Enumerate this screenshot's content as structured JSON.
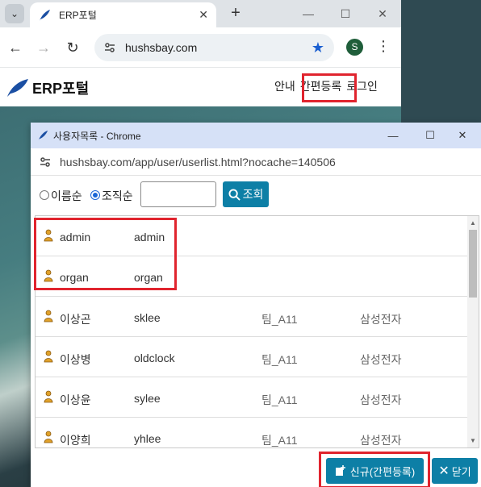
{
  "browser": {
    "tab_title": "ERP포털",
    "url": "hushsbay.com",
    "profile_initial": "S"
  },
  "site": {
    "brand": "ERP포털",
    "nav": [
      "안내",
      "간편등록",
      "로그인"
    ]
  },
  "popup": {
    "title": "사용자목록 - Chrome",
    "url": "hushsbay.com/app/user/userlist.html?nocache=140506",
    "search": {
      "radio_name": "이름순",
      "radio_org": "조직순",
      "selected": "조직순",
      "input_value": "",
      "search_button": "조회"
    },
    "users": [
      {
        "name": "admin",
        "id": "admin",
        "team": "",
        "company": ""
      },
      {
        "name": "organ",
        "id": "organ",
        "team": "",
        "company": ""
      },
      {
        "name": "이상곤",
        "id": "sklee",
        "team": "팀_A11",
        "company": "삼성전자"
      },
      {
        "name": "이상병",
        "id": "oldclock",
        "team": "팀_A11",
        "company": "삼성전자"
      },
      {
        "name": "이상윤",
        "id": "sylee",
        "team": "팀_A11",
        "company": "삼성전자"
      },
      {
        "name": "이양희",
        "id": "yhlee",
        "team": "팀_A11",
        "company": "삼성전자"
      }
    ],
    "buttons": {
      "new": "신규(간편등록)",
      "close": "닫기"
    }
  },
  "colors": {
    "accent": "#0d7fa6",
    "highlight": "#e0242e",
    "popup_titlebar": "#d6e1f7"
  }
}
